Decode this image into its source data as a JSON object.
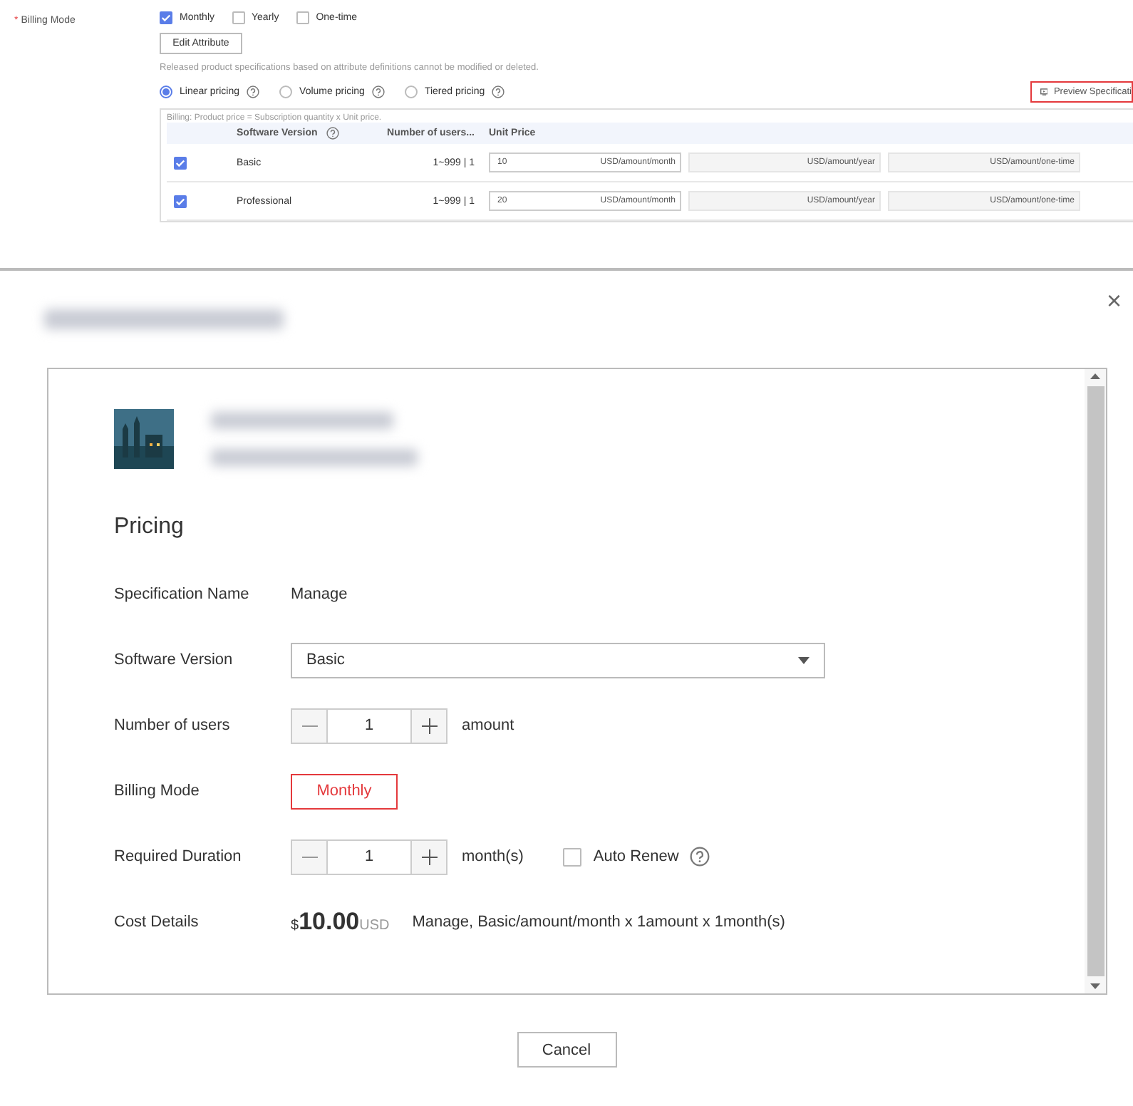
{
  "form": {
    "billing_label": "Billing Mode",
    "required_mark": "*",
    "billing_options": [
      {
        "label": "Monthly",
        "checked": true
      },
      {
        "label": "Yearly",
        "checked": false
      },
      {
        "label": "One-time",
        "checked": false
      }
    ],
    "edit_button": "Edit Attribute",
    "note": "Released product specifications based on attribute definitions cannot be modified or deleted.",
    "pricing_types": [
      {
        "label": "Linear pricing",
        "selected": true
      },
      {
        "label": "Volume pricing",
        "selected": false
      },
      {
        "label": "Tiered pricing",
        "selected": false
      }
    ],
    "preview_button": "Preview Specificati",
    "table": {
      "caption": "Billing: Product price = Subscription quantity x Unit price.",
      "columns": [
        "Software Version",
        "Number of users...",
        "Unit Price"
      ],
      "rows": [
        {
          "checked": true,
          "version": "Basic",
          "users": "1~999 | 1",
          "units": [
            {
              "value": "10",
              "unit": "USD/amount/month",
              "disabled": false
            },
            {
              "unit": "USD/amount/year",
              "disabled": true
            },
            {
              "unit": "USD/amount/one-time",
              "disabled": true
            }
          ]
        },
        {
          "checked": true,
          "version": "Professional",
          "users": "1~999 | 1",
          "units": [
            {
              "value": "20",
              "unit": "USD/amount/month",
              "disabled": false
            },
            {
              "unit": "USD/amount/year",
              "disabled": true
            },
            {
              "unit": "USD/amount/one-time",
              "disabled": true
            }
          ]
        }
      ]
    }
  },
  "dialog": {
    "close": "×",
    "cancel": "Cancel",
    "preview": {
      "section_title": "Pricing",
      "rows": [
        {
          "kind": "text",
          "label": "Specification Name",
          "value": "Manage"
        },
        {
          "kind": "select",
          "label": "Software Version",
          "value": "Basic"
        },
        {
          "kind": "stepper",
          "label": "Number of users",
          "value": "1",
          "unit": "amount"
        },
        {
          "kind": "options",
          "label": "Billing Mode",
          "options": [
            {
              "label": "Monthly",
              "selected": true
            }
          ]
        },
        {
          "kind": "stepper",
          "label": "Required Duration",
          "value": "1",
          "unit": "month(s)",
          "auto_renew": {
            "label": "Auto Renew",
            "checked": false
          }
        },
        {
          "kind": "cost",
          "label": "Cost Details",
          "symbol": "$",
          "amount": "10.00",
          "currency": "USD",
          "detail": "Manage, Basic/amount/month x 1amount x 1month(s)"
        }
      ]
    }
  }
}
